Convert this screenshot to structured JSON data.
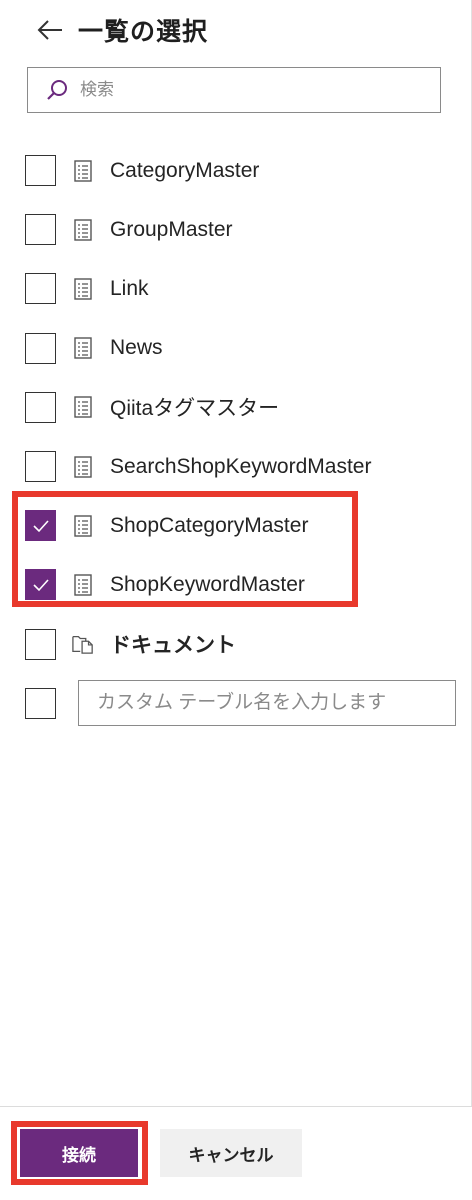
{
  "header": {
    "title": "一覧の選択"
  },
  "search": {
    "placeholder": "検索",
    "value": ""
  },
  "items": [
    {
      "label": "CategoryMaster",
      "checked": false,
      "icon": "list-icon"
    },
    {
      "label": "GroupMaster",
      "checked": false,
      "icon": "list-icon"
    },
    {
      "label": "Link",
      "checked": false,
      "icon": "list-icon"
    },
    {
      "label": "News",
      "checked": false,
      "icon": "list-icon"
    },
    {
      "label": "Qiitaタグマスター",
      "checked": false,
      "icon": "list-icon"
    },
    {
      "label": "SearchShopKeywordMaster",
      "checked": false,
      "icon": "list-icon"
    },
    {
      "label": "ShopCategoryMaster",
      "checked": true,
      "icon": "list-icon"
    },
    {
      "label": "ShopKeywordMaster",
      "checked": true,
      "icon": "list-icon"
    },
    {
      "label": "ドキュメント",
      "checked": false,
      "icon": "document-library-icon"
    }
  ],
  "custom": {
    "placeholder": "カスタム テーブル名を入力します",
    "value": "",
    "checked": false
  },
  "footer": {
    "connect_label": "接続",
    "cancel_label": "キャンセル"
  },
  "colors": {
    "accent": "#6b2a7e",
    "highlight": "#e8392c"
  }
}
